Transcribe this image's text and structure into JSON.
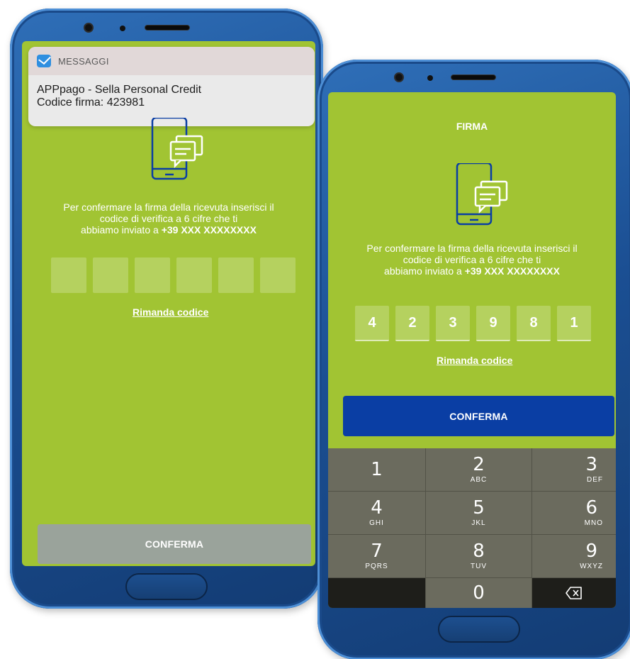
{
  "left_phone": {
    "notification": {
      "app_name": "MESSAGGI",
      "line1": "APPpago - Sella Personal Credit",
      "line2": "Codice firma: 423981"
    },
    "instruction_line1": "Per confermare la firma della ricevuta inserisci il",
    "instruction_line2": "codice di verifica a 6 cifre che ti",
    "instruction_line3": "abbiamo inviato a",
    "phone_number": "+39 XXX XXXXXXXX",
    "code_digits": [
      "",
      "",
      "",
      "",
      "",
      ""
    ],
    "resend_label": "Rimanda codice",
    "confirm_label": "CONFERMA",
    "confirm_color": "#9aa39b"
  },
  "right_phone": {
    "title": "FIRMA",
    "instruction_line1": "Per confermare la firma della ricevuta inserisci il",
    "instruction_line2": "codice di verifica a 6 cifre che ti",
    "instruction_line3": "abbiamo inviato a",
    "phone_number": "+39 XXX XXXXXXXX",
    "code_digits": [
      "4",
      "2",
      "3",
      "9",
      "8",
      "1"
    ],
    "resend_label": "Rimanda codice",
    "confirm_label": "CONFERMA",
    "confirm_color": "#0a3ea4",
    "keypad": {
      "keys": [
        {
          "num": "1",
          "letters": ""
        },
        {
          "num": "2",
          "letters": "ABC"
        },
        {
          "num": "3",
          "letters": "DEF"
        },
        {
          "num": "4",
          "letters": "GHI"
        },
        {
          "num": "5",
          "letters": "JKL"
        },
        {
          "num": "6",
          "letters": "MNO"
        },
        {
          "num": "7",
          "letters": "PQRS"
        },
        {
          "num": "8",
          "letters": "TUV"
        },
        {
          "num": "9",
          "letters": "WXYZ"
        },
        {
          "num": "0",
          "letters": ""
        }
      ],
      "backspace_icon": "backspace-icon"
    }
  },
  "colors": {
    "screen_green": "#a1c433",
    "phone_blue": "#1b4f93",
    "icon_blue": "#0a3ea4"
  }
}
